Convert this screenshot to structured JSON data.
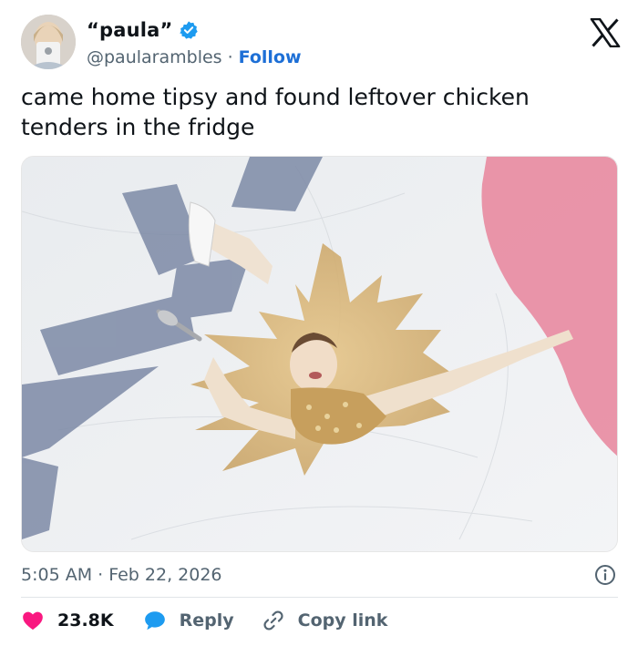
{
  "tweet": {
    "display_name": "“paula”",
    "handle": "@paularambles",
    "separator": "·",
    "follow_label": "Follow",
    "text": "came home tipsy and found leftover chicken tenders in the fridge",
    "timestamp": "5:05 AM · Feb 22, 2026"
  },
  "actions": {
    "likes": "23.8K",
    "reply_label": "Reply",
    "copy_label": "Copy link"
  },
  "colors": {
    "link_blue": "#1d6fd6",
    "like_red": "#f91880",
    "reply_blue": "#1d9bf0",
    "muted_gray": "#536471"
  },
  "icons": {
    "verified": "verified-badge-icon",
    "brand": "x-logo-icon",
    "info": "info-icon",
    "like": "heart-icon",
    "reply": "speech-bubble-icon",
    "copy": "link-icon"
  }
}
